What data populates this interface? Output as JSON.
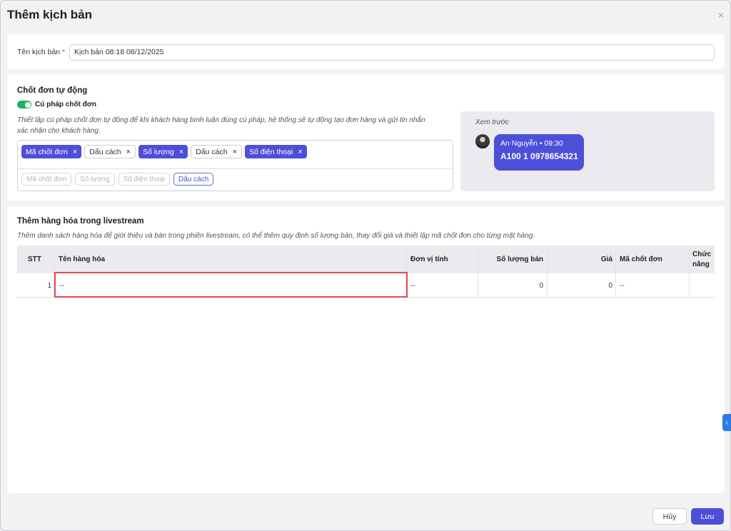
{
  "dialog": {
    "title": "Thêm kịch bản",
    "close_icon": "×"
  },
  "name_field": {
    "label": "Tên kịch bản",
    "required_mark": "*",
    "value": "Kịch bản 08:18 08/12/2025"
  },
  "auto_order": {
    "title": "Chốt đơn tự động",
    "toggle_label": "Cú pháp chốt đơn",
    "toggle_on": true,
    "description_line1": "Thiết lập cú pháp chốt đơn tự động để khi khách hàng bình luận đúng cú pháp, hệ thống sẽ tự động tạo đơn hàng và gửi tin nhắn",
    "description_line2": "xác nhận cho khách hàng.",
    "tags": [
      {
        "label": "Mã chốt đơn",
        "style": "filled"
      },
      {
        "label": "Dấu cách",
        "style": "outline"
      },
      {
        "label": "Số lượng",
        "style": "filled"
      },
      {
        "label": "Dấu cách",
        "style": "outline"
      },
      {
        "label": "Số điện thoại",
        "style": "filled"
      }
    ],
    "tag_remove_icon": "×",
    "options": [
      "Mã chốt đơn",
      "Số lượng",
      "Số điện thoại",
      "Dấu cách"
    ],
    "preview": {
      "title": "Xem trước",
      "author": "An Nguyễn • 09:30",
      "message": "A100 1 0978654321"
    }
  },
  "products": {
    "title": "Thêm hàng hóa trong livestream",
    "description": "Thêm danh sách hàng hóa để giới thiệu và bán trong phiên livestream, có thể thêm quy định số lượng bán, thay đổi giá và thiết lập mã chốt đơn cho từng mặt hàng.",
    "columns": {
      "stt": "STT",
      "name": "Tên hàng hóa",
      "unit": "Đơn vị tính",
      "qty": "Số lượng bán",
      "price": "Giá",
      "code": "Mã chốt đơn",
      "func_line1": "Chức",
      "func_line2": "năng"
    },
    "rows": [
      {
        "stt": "1",
        "name": "--",
        "unit": "--",
        "qty": "0",
        "price": "0",
        "code": "--"
      }
    ]
  },
  "footer": {
    "cancel_label": "Hủy",
    "save_label": "Lưu"
  },
  "side_tab_icon": "‹",
  "colors": {
    "primary": "#4e4fd8",
    "toggle": "#1db35a",
    "highlight": "#e5484d",
    "side_tab": "#2b7be4"
  }
}
